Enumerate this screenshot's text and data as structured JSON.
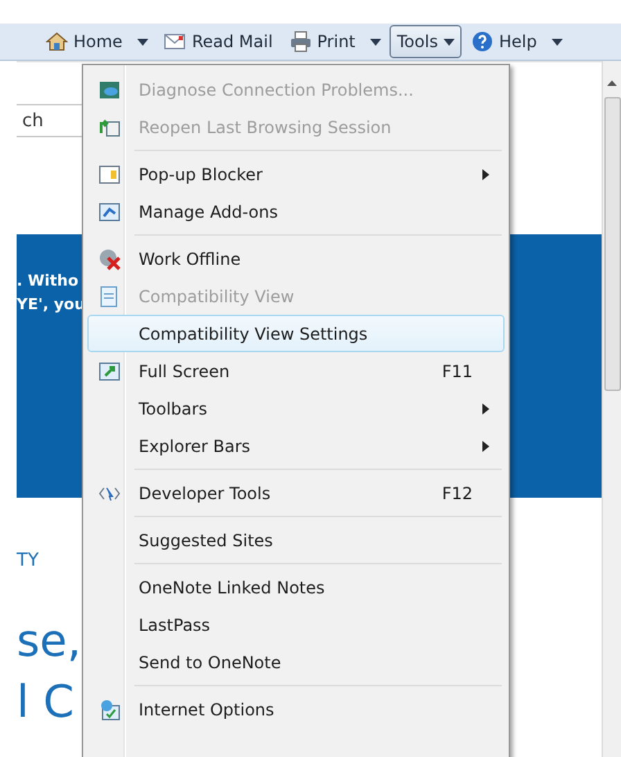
{
  "toolbar": {
    "buttons": [
      {
        "label": "Home",
        "has_menu": true,
        "pressed": false
      },
      {
        "label": "Read Mail",
        "has_menu": false,
        "pressed": false
      },
      {
        "label": "Print",
        "has_menu": true,
        "pressed": false
      },
      {
        "label": "Tools",
        "has_menu": true,
        "pressed": true
      },
      {
        "label": "Help",
        "has_menu": true,
        "pressed": false
      }
    ]
  },
  "page": {
    "search": {
      "value": "ch"
    },
    "banner_lines": [
      ". Witho",
      "YE', you"
    ],
    "section_label": "TY",
    "headline_lines": [
      "se,",
      "l C"
    ]
  },
  "menu": {
    "items": [
      {
        "kind": "item",
        "label": "Diagnose Connection Problems...",
        "disabled": true,
        "selected": false
      },
      {
        "kind": "item",
        "label": "Reopen Last Browsing Session",
        "disabled": true,
        "selected": false
      },
      {
        "kind": "separator"
      },
      {
        "kind": "item",
        "label": "Pop-up Blocker",
        "disabled": false,
        "selected": false,
        "submenu": true
      },
      {
        "kind": "item",
        "label": "Manage Add-ons",
        "disabled": false,
        "selected": false
      },
      {
        "kind": "separator"
      },
      {
        "kind": "item",
        "label": "Work Offline",
        "disabled": false,
        "selected": false
      },
      {
        "kind": "item",
        "label": "Compatibility View",
        "disabled": true,
        "selected": false
      },
      {
        "kind": "item",
        "label": "Compatibility View Settings",
        "disabled": false,
        "selected": true
      },
      {
        "kind": "item",
        "label": "Full Screen",
        "disabled": false,
        "selected": false,
        "shortcut": "F11"
      },
      {
        "kind": "item",
        "label": "Toolbars",
        "disabled": false,
        "selected": false,
        "submenu": true
      },
      {
        "kind": "item",
        "label": "Explorer Bars",
        "disabled": false,
        "selected": false,
        "submenu": true
      },
      {
        "kind": "separator"
      },
      {
        "kind": "item",
        "label": "Developer Tools",
        "disabled": false,
        "selected": false,
        "shortcut": "F12"
      },
      {
        "kind": "separator"
      },
      {
        "kind": "item",
        "label": "Suggested Sites",
        "disabled": false,
        "selected": false
      },
      {
        "kind": "separator"
      },
      {
        "kind": "item",
        "label": "OneNote Linked Notes",
        "disabled": false,
        "selected": false
      },
      {
        "kind": "item",
        "label": "LastPass",
        "disabled": false,
        "selected": false
      },
      {
        "kind": "item",
        "label": "Send to OneNote",
        "disabled": false,
        "selected": false
      },
      {
        "kind": "separator"
      },
      {
        "kind": "item",
        "label": "Internet Options",
        "disabled": false,
        "selected": false
      }
    ]
  }
}
